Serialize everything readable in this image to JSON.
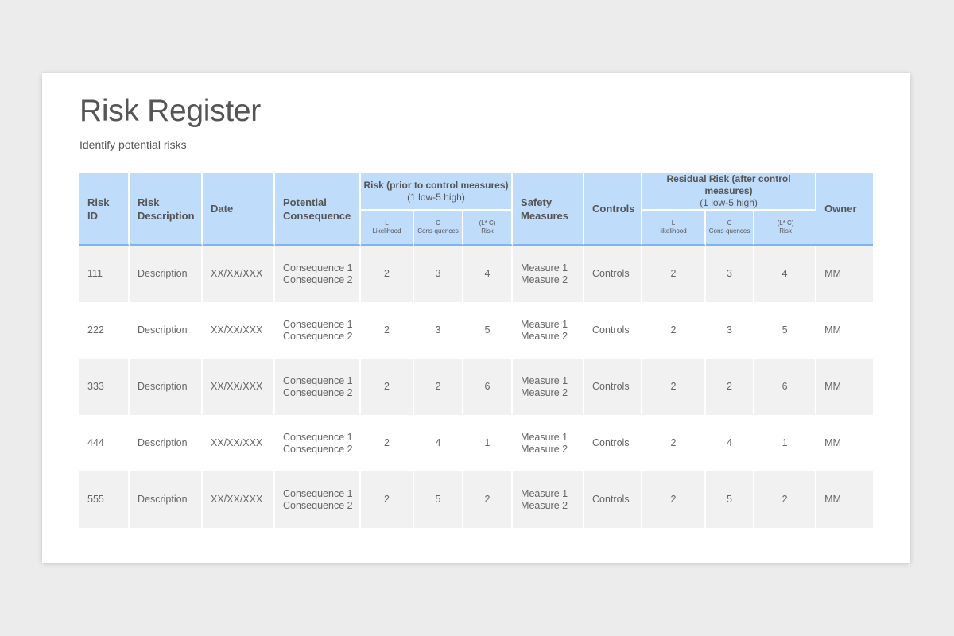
{
  "title": "Risk Register",
  "subtitle": "Identify potential  risks",
  "colors": {
    "header_bg": "#bfdcfb",
    "header_border": "#7fb5ef",
    "row_alt_bg": "#f1f1f1",
    "text": "#555555"
  },
  "table": {
    "headers": {
      "risk_id": "Risk ID",
      "risk_description": "Risk Description",
      "date": "Date",
      "potential_consequence": "Potential Consequence",
      "risk_group": {
        "title": "Risk (prior to control measures)",
        "subtitle": "(1 low-5 high)",
        "columns": [
          {
            "letter": "L",
            "label": "Likelihood"
          },
          {
            "letter": "C",
            "label": "Cons-quences"
          },
          {
            "letter": "(L* C)",
            "label": "Risk"
          }
        ]
      },
      "safety_measures": "Safety Measures",
      "controls": "Controls",
      "residual_group": {
        "title": "Residual Risk (after control measures)",
        "subtitle": "(1 low-5 high)",
        "columns": [
          {
            "letter": "L",
            "label": "likelihood"
          },
          {
            "letter": "C",
            "label": "Cons-quences"
          },
          {
            "letter": "(L* C)",
            "label": "Risk"
          }
        ]
      },
      "owner": "Owner"
    },
    "rows": [
      {
        "id": "111",
        "description": "Description",
        "date": "XX/XX/XXX",
        "consequence_1": "Consequence 1",
        "consequence_2": "Consequence 2",
        "l": "2",
        "c": "3",
        "risk": "4",
        "measure_1": "Measure 1",
        "measure_2": "Measure 2",
        "controls": "Controls",
        "res_l": "2",
        "res_c": "3",
        "res_risk": "4",
        "owner": "MM"
      },
      {
        "id": "222",
        "description": "Description",
        "date": "XX/XX/XXX",
        "consequence_1": "Consequence 1",
        "consequence_2": "Consequence 2",
        "l": "2",
        "c": "3",
        "risk": "5",
        "measure_1": "Measure 1",
        "measure_2": "Measure 2",
        "controls": "Controls",
        "res_l": "2",
        "res_c": "3",
        "res_risk": "5",
        "owner": "MM"
      },
      {
        "id": "333",
        "description": "Description",
        "date": "XX/XX/XXX",
        "consequence_1": "Consequence 1",
        "consequence_2": "Consequence 2",
        "l": "2",
        "c": "2",
        "risk": "6",
        "measure_1": "Measure 1",
        "measure_2": "Measure 2",
        "controls": "Controls",
        "res_l": "2",
        "res_c": "2",
        "res_risk": "6",
        "owner": "MM"
      },
      {
        "id": "444",
        "description": "Description",
        "date": "XX/XX/XXX",
        "consequence_1": "Consequence 1",
        "consequence_2": "Consequence 2",
        "l": "2",
        "c": "4",
        "risk": "1",
        "measure_1": "Measure 1",
        "measure_2": "Measure 2",
        "controls": "Controls",
        "res_l": "2",
        "res_c": "4",
        "res_risk": "1",
        "owner": "MM"
      },
      {
        "id": "555",
        "description": "Description",
        "date": "XX/XX/XXX",
        "consequence_1": "Consequence 1",
        "consequence_2": "Consequence 2",
        "l": "2",
        "c": "5",
        "risk": "2",
        "measure_1": "Measure 1",
        "measure_2": "Measure 2",
        "controls": "Controls",
        "res_l": "2",
        "res_c": "5",
        "res_risk": "2",
        "owner": "MM"
      }
    ]
  }
}
